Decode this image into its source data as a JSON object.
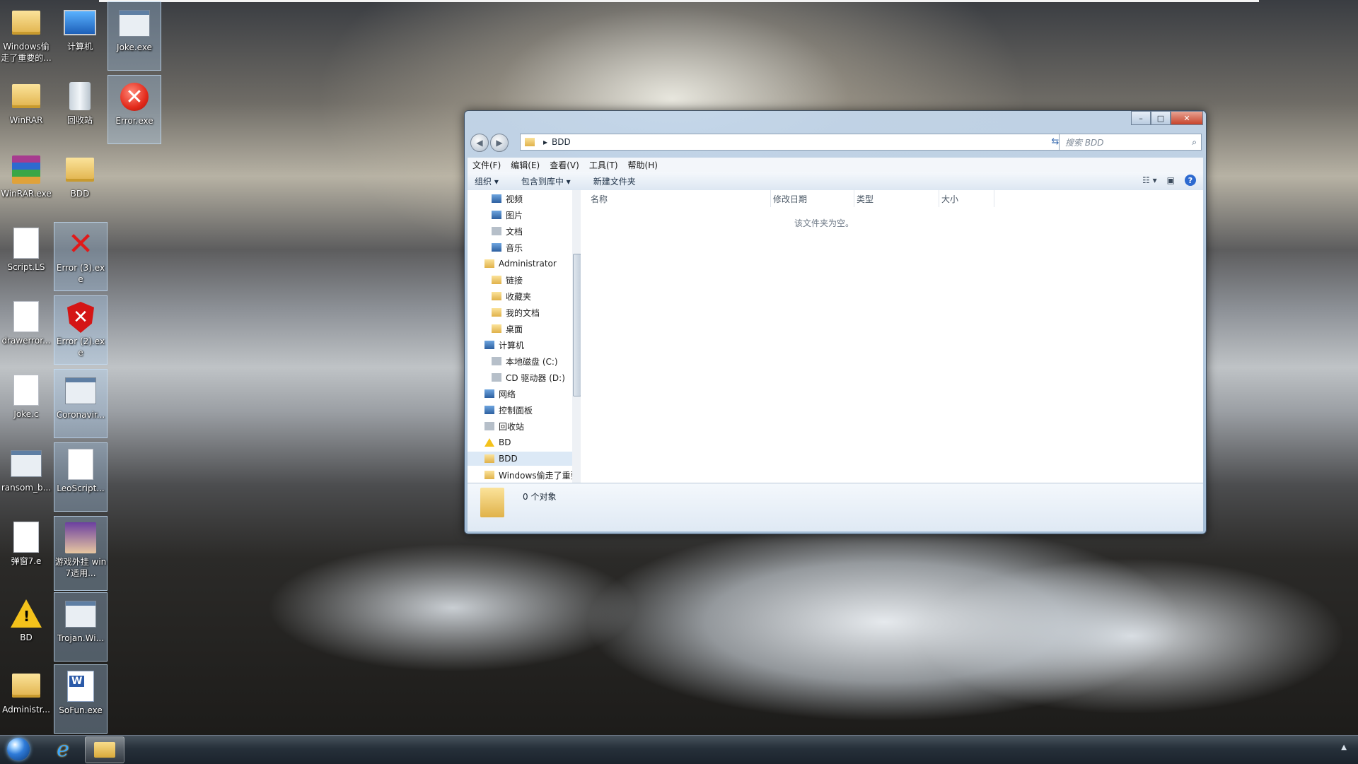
{
  "desktop": {
    "icons": [
      {
        "label": "Windows偷走了重要的...",
        "kind": "folder"
      },
      {
        "label": "计算机",
        "kind": "computer"
      },
      {
        "label": "Joke.exe",
        "kind": "exe"
      },
      {
        "label": "WinRAR",
        "kind": "folder"
      },
      {
        "label": "回收站",
        "kind": "recycle-bin"
      },
      {
        "label": "Error.exe",
        "kind": "error"
      },
      {
        "label": "WinRAR.exe",
        "kind": "winrar"
      },
      {
        "label": "BDD",
        "kind": "folder"
      },
      {
        "label": "Script.LS",
        "kind": "document"
      },
      {
        "label": "Error (3).exe",
        "kind": "error-x"
      },
      {
        "label": "drawerror...",
        "kind": "document"
      },
      {
        "label": "Error (2).exe",
        "kind": "error-shield"
      },
      {
        "label": "Joke.c",
        "kind": "document"
      },
      {
        "label": "Coronavir...",
        "kind": "exe"
      },
      {
        "label": "ransom_b...",
        "kind": "exe"
      },
      {
        "label": "LeoScript...",
        "kind": "document"
      },
      {
        "label": "弹窗7.e",
        "kind": "document"
      },
      {
        "label": "游戏外挂 win7适用...",
        "kind": "anime"
      },
      {
        "label": "BD",
        "kind": "warning"
      },
      {
        "label": "Trojan.Wi...",
        "kind": "exe"
      },
      {
        "label": "Administr...",
        "kind": "folder"
      },
      {
        "label": "SoFun.exe",
        "kind": "word"
      }
    ]
  },
  "window": {
    "controls": {
      "minimize": "–",
      "maximize": "□",
      "close": "✕"
    },
    "nav": {
      "back": "◀",
      "forward": "▶"
    },
    "address": {
      "breadcrumb_sep": "▸",
      "path": "BDD",
      "dropdown": "▾",
      "refresh": "⇆"
    },
    "search": {
      "placeholder": "搜索 BDD",
      "icon": "⌕"
    },
    "menu": [
      "文件(F)",
      "编辑(E)",
      "查看(V)",
      "工具(T)",
      "帮助(H)"
    ],
    "toolbar": {
      "organize": "组织 ▾",
      "include_library": "包含到库中 ▾",
      "new_folder": "新建文件夹",
      "view_icon": "☷ ▾",
      "pane_icon": "▣",
      "help": "?"
    },
    "nav_pane": [
      {
        "label": "视频",
        "icon": "b"
      },
      {
        "label": "图片",
        "icon": "b"
      },
      {
        "label": "文档",
        "icon": "g"
      },
      {
        "label": "音乐",
        "icon": "b"
      },
      {
        "label": "Administrator",
        "icon": "f"
      },
      {
        "label": "链接",
        "icon": "f"
      },
      {
        "label": "收藏夹",
        "icon": "f"
      },
      {
        "label": "我的文档",
        "icon": "f"
      },
      {
        "label": "桌面",
        "icon": "f"
      },
      {
        "label": "计算机",
        "icon": "b"
      },
      {
        "label": "本地磁盘 (C:)",
        "icon": "g"
      },
      {
        "label": "CD 驱动器 (D:)",
        "icon": "g"
      },
      {
        "label": "网络",
        "icon": "b"
      },
      {
        "label": "控制面板",
        "icon": "b"
      },
      {
        "label": "回收站",
        "icon": "g"
      },
      {
        "label": "BD",
        "icon": "w"
      },
      {
        "label": "BDD",
        "icon": "f"
      },
      {
        "label": "Windows偷走了重要",
        "icon": "f"
      }
    ],
    "columns": [
      "名称",
      "修改日期",
      "类型",
      "大小"
    ],
    "empty_message": "该文件夹为空。",
    "status_count": "0 个对象"
  },
  "taskbar": {
    "tray_arrow": "▲"
  }
}
